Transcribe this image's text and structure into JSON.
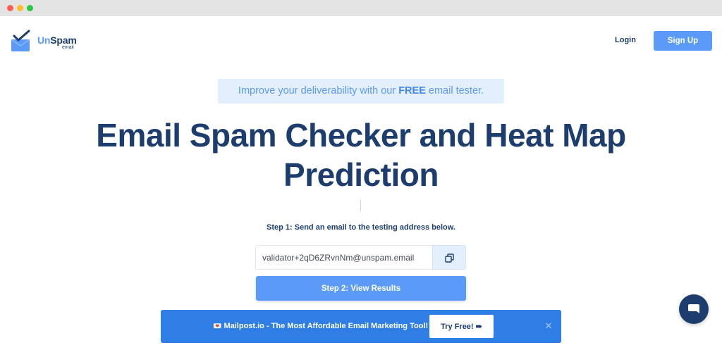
{
  "brand": {
    "name_part1": "Un",
    "name_part2": "Spam",
    "subtitle": "email",
    "primary_color": "#5b9bf7",
    "dark_color": "#1c3d6d"
  },
  "nav": {
    "login_label": "Login",
    "signup_label": "Sign Up"
  },
  "promo": {
    "text_before": "Improve your deliverability with our ",
    "text_bold": "FREE",
    "text_after": " email tester."
  },
  "hero": {
    "title": "Email Spam Checker and Heat Map Prediction"
  },
  "steps": {
    "step1_label": "Step 1: Send an email to the testing address below.",
    "address_value": "validator+2qD6ZRvnNm@unspam.email",
    "copy_icon": "copy-icon",
    "step2_label": "Step 2: View Results"
  },
  "ad": {
    "heart_icon": "💌",
    "text": "Mailpost.io - The Most Affordable Email Marketing Tool!",
    "button_label": "Try Free! ➠",
    "close_icon": "✕",
    "bar_color": "#2e7ee6"
  },
  "chat": {
    "icon": "chat-bubble-icon"
  }
}
